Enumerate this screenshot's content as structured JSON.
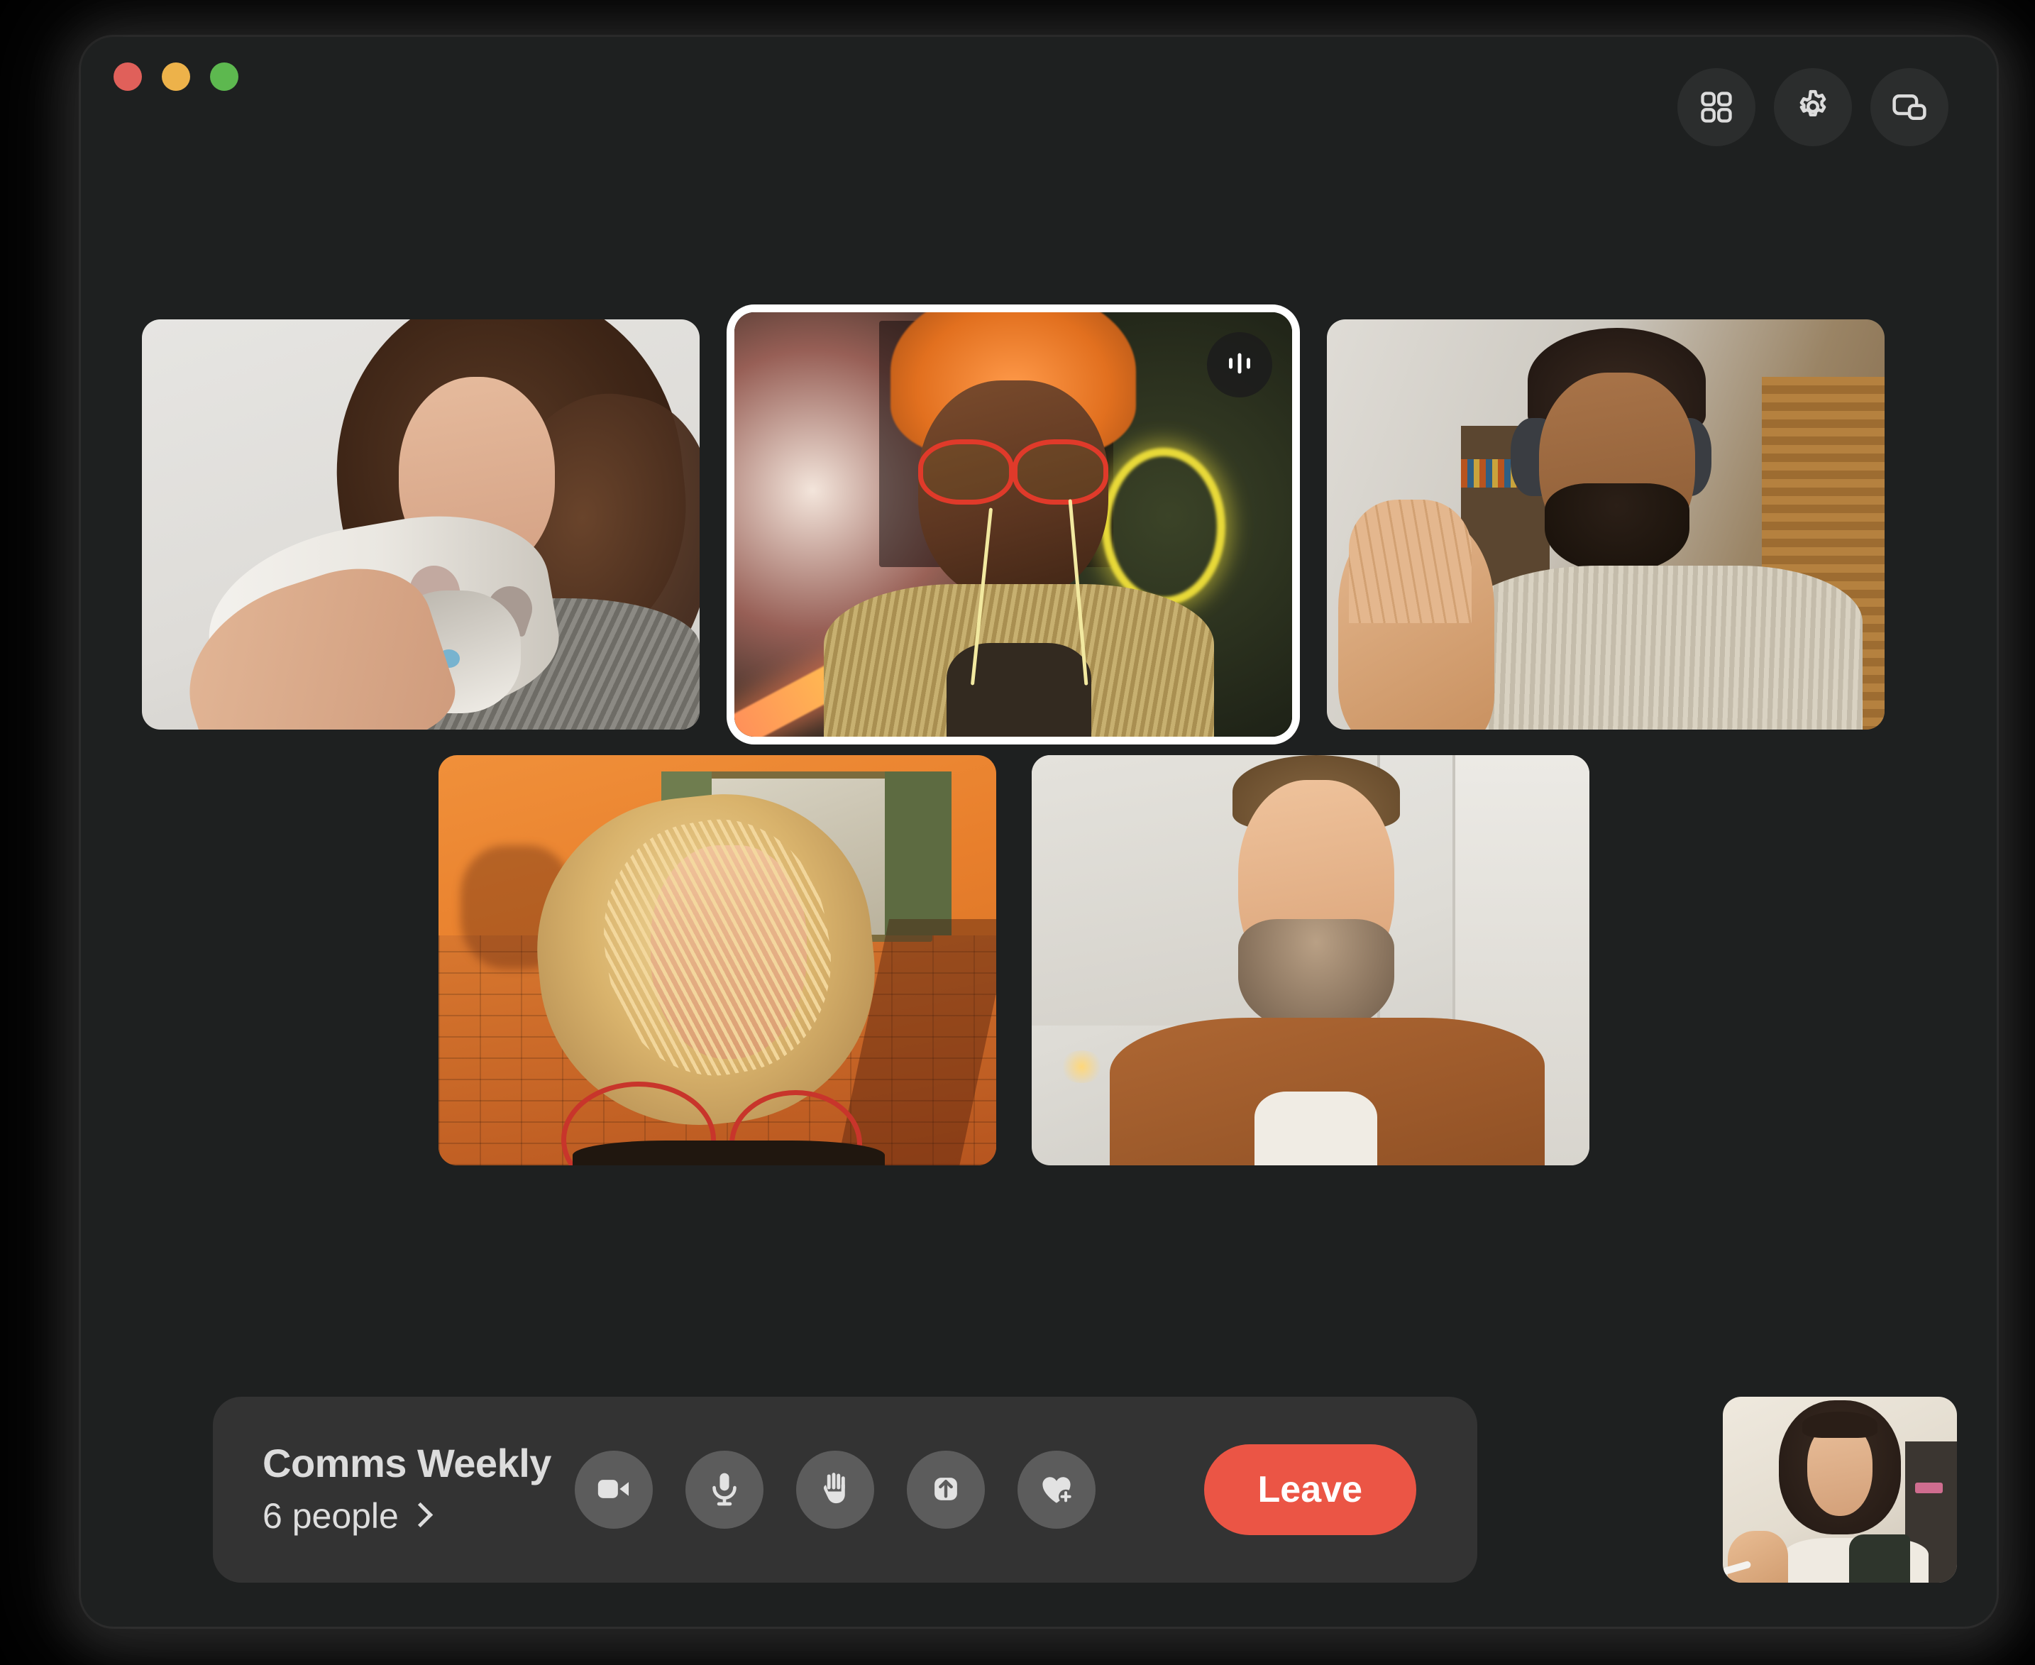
{
  "window": {
    "traffic_lights": [
      {
        "name": "close",
        "color": "#e0605a"
      },
      {
        "name": "minimize",
        "color": "#edb24a"
      },
      {
        "name": "zoom",
        "color": "#5db84f"
      }
    ],
    "background_color": "#1e2020"
  },
  "header": {
    "actions": [
      {
        "icon": "grid-layout-icon",
        "label": "Grid layout"
      },
      {
        "icon": "gear-icon",
        "label": "Settings"
      },
      {
        "icon": "picture-in-picture-icon",
        "label": "Picture in picture"
      }
    ]
  },
  "stage": {
    "tiles": [
      {
        "id": "tile-1",
        "participant": "Woman holding a cat",
        "scene": "woman with curly brown hair holding a white and gray cat against a light gray wall",
        "speaking": false
      },
      {
        "id": "tile-2",
        "participant": "Woman with red glasses",
        "scene": "woman with orange curly hair, red aviator glasses and yellow wired earbuds in a neon-lit room",
        "speaking": true,
        "badge_icon": "audio-waveform-icon"
      },
      {
        "id": "tile-3",
        "participant": "Man waving with headphones",
        "scene": "smiling man in cream ribbed sweater wearing over-ear headphones, waving, bookshelf and wooden door behind",
        "speaking": false
      },
      {
        "id": "tile-4",
        "participant": "Woman outdoors at golden hour",
        "scene": "blonde woman with windswept hair in front of an orange stucco and brick wall with green shutters",
        "speaking": false
      },
      {
        "id": "tile-5",
        "participant": "Bearded man in kitchen",
        "scene": "bearded man in a rust corduroy jacket wearing wireless earbuds in a white kitchen with candles",
        "speaking": false
      }
    ]
  },
  "controlbar": {
    "meeting_title": "Comms Weekly",
    "people_label": "6 people",
    "people_chevron": "chevron-right-icon",
    "buttons": [
      {
        "name": "camera-button",
        "icon": "video-camera-icon",
        "label": "Camera"
      },
      {
        "name": "microphone-button",
        "icon": "microphone-icon",
        "label": "Microphone"
      },
      {
        "name": "raise-hand-button",
        "icon": "raised-hand-icon",
        "label": "Raise hand"
      },
      {
        "name": "share-button",
        "icon": "share-up-arrow-icon",
        "label": "Share"
      },
      {
        "name": "reactions-button",
        "icon": "heart-plus-icon",
        "label": "Reactions"
      }
    ],
    "leave_label": "Leave",
    "leave_color": "#eb5545",
    "bar_color": "#333333",
    "button_color": "#5c5c5c"
  },
  "self_view": {
    "participant": "You",
    "scene": "woman with dark bob hair and bangs in dark overalls over a white shirt, holding a white pen"
  }
}
